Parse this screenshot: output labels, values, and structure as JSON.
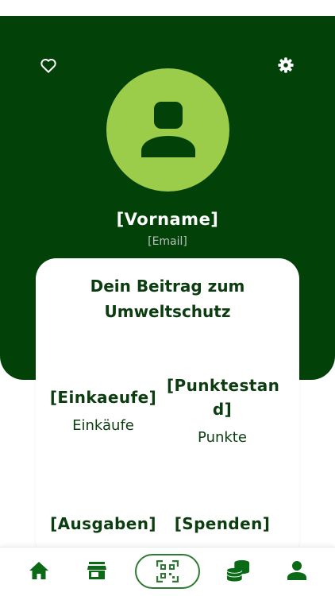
{
  "header": {
    "favorites_icon": "heart-outline-icon",
    "settings_icon": "gear-icon",
    "avatar_icon": "person-icon"
  },
  "profile": {
    "name": "[Vorname]",
    "email": "[Email]"
  },
  "card": {
    "title_line1": "Dein Beitrag zum",
    "title_line2": "Umweltschutz"
  },
  "stats": {
    "einkaeufe": {
      "value": "[Einkaeufe]",
      "label": "Einkäufe"
    },
    "punkte": {
      "value_line1": "[Punktestan",
      "value_line2": "d]",
      "label": "Punkte"
    },
    "ausgaben": {
      "value": "[Ausgaben]"
    },
    "spenden": {
      "value": "[Spenden]"
    }
  },
  "bottom_nav": {
    "items": [
      {
        "icon": "home-icon"
      },
      {
        "icon": "store-icon"
      },
      {
        "icon": "qr-scan-icon"
      },
      {
        "icon": "coins-icon"
      },
      {
        "icon": "person-icon"
      }
    ]
  },
  "colors": {
    "header_bg": "#024209",
    "avatar_bg": "#9bcc4a",
    "accent": "#2f7a33",
    "text_dark": "#0c3d10"
  }
}
